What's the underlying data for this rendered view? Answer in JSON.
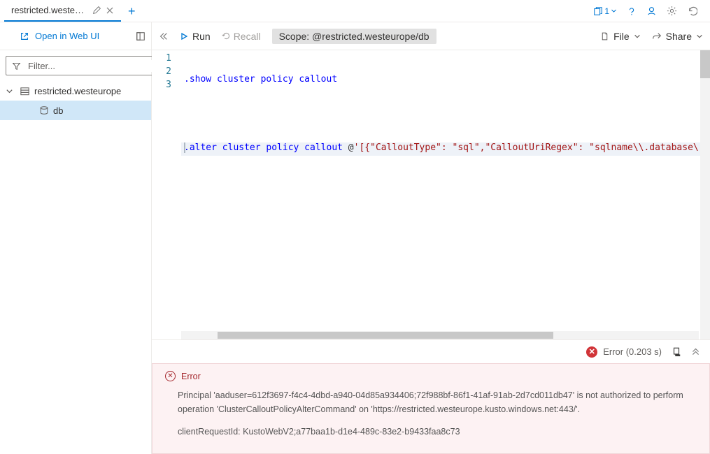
{
  "tabs": {
    "active_title": "restricted.westeur..."
  },
  "tab_count": "1",
  "sidebar": {
    "open_web_ui": "Open in Web UI",
    "filter_placeholder": "Filter...",
    "cluster": "restricted.westeurope",
    "db": "db"
  },
  "toolbar": {
    "run": "Run",
    "recall": "Recall",
    "scope_label": "Scope:",
    "scope_value": "@restricted.westeurope/db",
    "file": "File",
    "share": "Share"
  },
  "editor": {
    "lines": {
      "n1": "1",
      "n2": "2",
      "n3": "3"
    },
    "line1_kw": ".show cluster policy callout",
    "line3_kw": ".alter cluster policy callout",
    "line3_at": " @",
    "line3_str": "'[{\"CalloutType\": \"sql\",\"CalloutUriRegex\": \"sqlname\\\\.database\\"
  },
  "status": {
    "text": "Error (0.203 s)"
  },
  "error": {
    "title": "Error",
    "body": "Principal 'aaduser=612f3697-f4c4-4dbd-a940-04d85a934406;72f988bf-86f1-41af-91ab-2d7cd011db47' is not authorized to perform operation 'ClusterCalloutPolicyAlterCommand' on 'https://restricted.westeurope.kusto.windows.net:443/'.",
    "req": "clientRequestId: KustoWebV2;a77baa1b-d1e4-489c-83e2-b9433faa8c73"
  }
}
